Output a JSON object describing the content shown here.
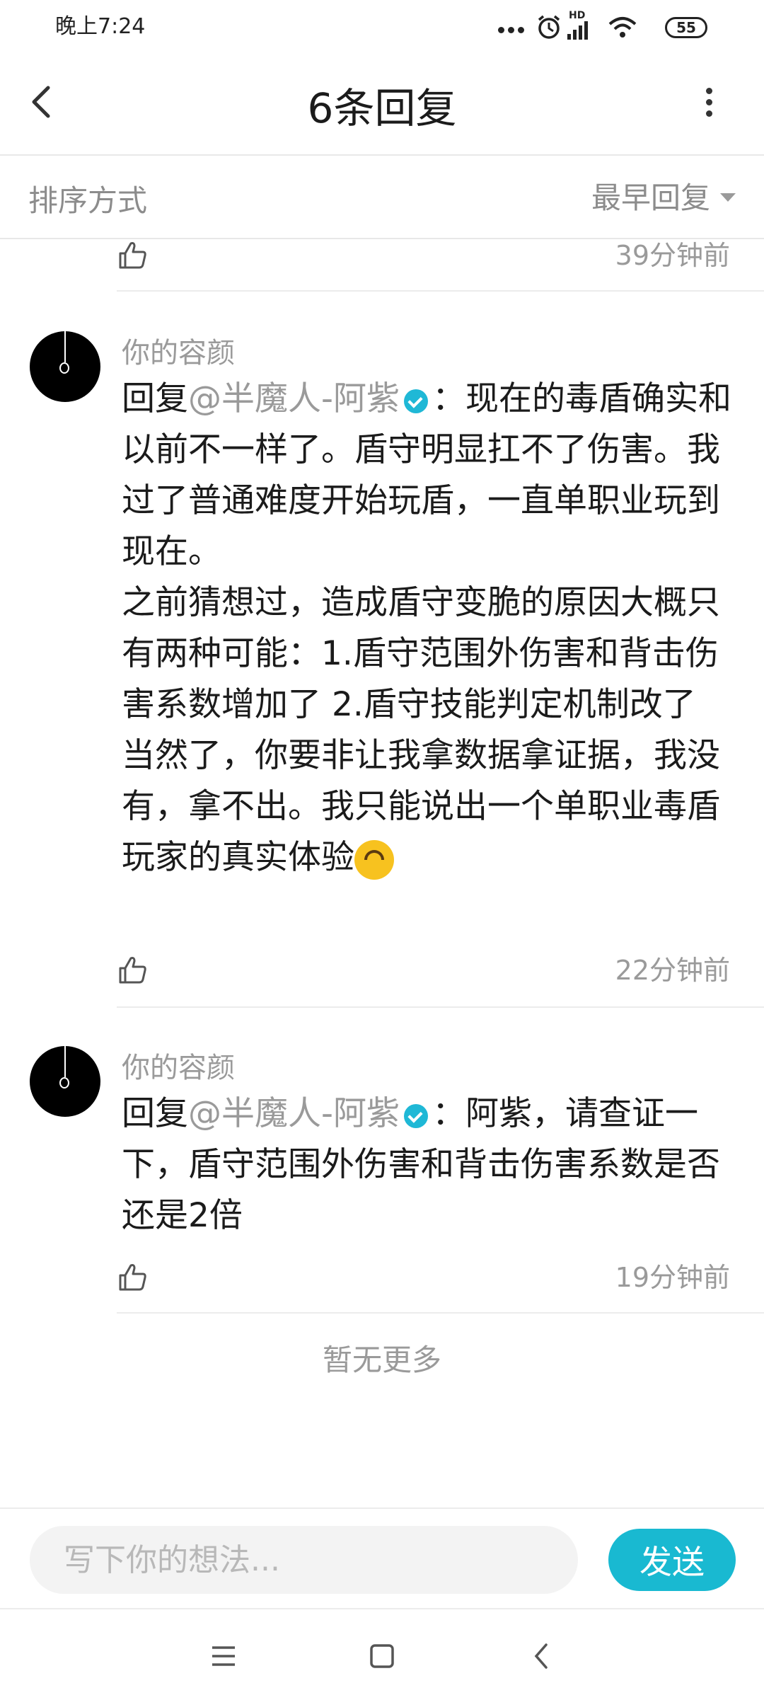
{
  "status_bar": {
    "time": "晚上7:24",
    "hd": "HD",
    "battery": "55"
  },
  "header": {
    "title": "6条回复"
  },
  "sort": {
    "label": "排序方式",
    "value": "最早回复"
  },
  "partial_comment": {
    "time": "39分钟前"
  },
  "comments": [
    {
      "user": "你的容颜",
      "reply_prefix": "回复",
      "mention": "@半魔人-阿紫",
      "text_1": "：现在的毒盾确实和以前不一样了。盾守明显扛不了伤害。我过了普通难度开始玩盾，一直单职业玩到现在。",
      "text_2": "之前猜想过，造成盾守变脆的原因大概只有两种可能：1.盾守范围外伤害和背击伤害系数增加了 2.盾守技能判定机制改了",
      "text_3": "当然了，你要非让我拿数据拿证据，我没有，拿不出。我只能说出一个单职业毒盾玩家的真实体验",
      "emoji": "upside-down-face",
      "time": "22分钟前"
    },
    {
      "user": "你的容颜",
      "reply_prefix": "回复",
      "mention": "@半魔人-阿紫",
      "text_1": "：阿紫，请查证一下，盾守范围外伤害和背击伤害系数是否还是2倍",
      "time": "19分钟前"
    }
  ],
  "no_more": "暂无更多",
  "input": {
    "placeholder": "写下你的想法...",
    "send_label": "发送"
  },
  "colors": {
    "accent": "#19b9d1",
    "verified": "#1fb8d6",
    "muted_text": "#9a9a9a"
  }
}
